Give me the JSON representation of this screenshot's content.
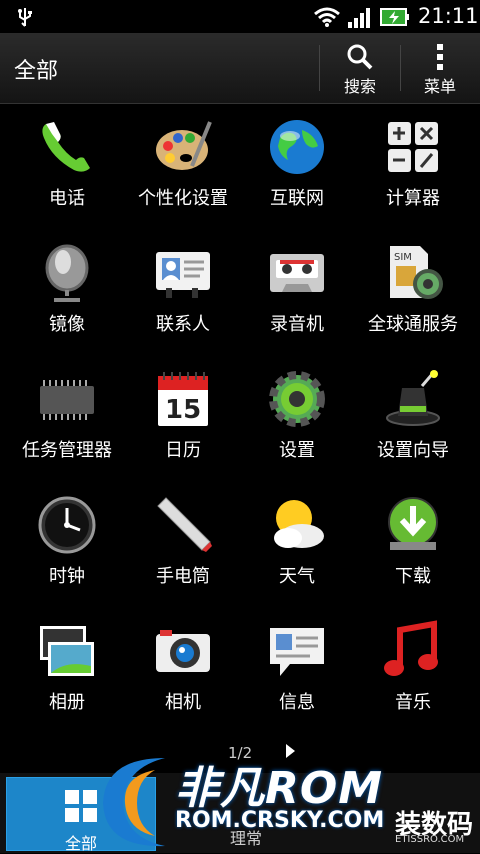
{
  "status": {
    "time": "21:11"
  },
  "header": {
    "title": "全部",
    "search_label": "搜索",
    "menu_label": "菜单"
  },
  "apps": [
    {
      "label": "电话",
      "icon": "phone-icon"
    },
    {
      "label": "个性化设置",
      "icon": "palette-icon"
    },
    {
      "label": "互联网",
      "icon": "globe-icon"
    },
    {
      "label": "计算器",
      "icon": "calculator-icon"
    },
    {
      "label": "镜像",
      "icon": "mirror-icon"
    },
    {
      "label": "联系人",
      "icon": "contacts-icon"
    },
    {
      "label": "录音机",
      "icon": "cassette-icon"
    },
    {
      "label": "全球通服务",
      "icon": "sim-icon"
    },
    {
      "label": "任务管理器",
      "icon": "chip-icon"
    },
    {
      "label": "日历",
      "icon": "calendar-icon"
    },
    {
      "label": "设置",
      "icon": "gear-icon"
    },
    {
      "label": "设置向导",
      "icon": "magic-hat-icon"
    },
    {
      "label": "时钟",
      "icon": "clock-icon"
    },
    {
      "label": "手电筒",
      "icon": "flashlight-icon"
    },
    {
      "label": "天气",
      "icon": "weather-icon"
    },
    {
      "label": "下载",
      "icon": "download-icon"
    },
    {
      "label": "相册",
      "icon": "gallery-icon"
    },
    {
      "label": "相机",
      "icon": "camera-icon"
    },
    {
      "label": "信息",
      "icon": "message-icon"
    },
    {
      "label": "音乐",
      "icon": "music-icon"
    }
  ],
  "calendar_day": "15",
  "pager": {
    "text": "1/2"
  },
  "bottom": {
    "all_label": "全部",
    "manage_label": "理常"
  },
  "watermark": {
    "brand": "非凡ROM",
    "site": "ROM.CRSKY.COM",
    "right": "装数码",
    "right_sub": "ETISSRO.COM"
  }
}
